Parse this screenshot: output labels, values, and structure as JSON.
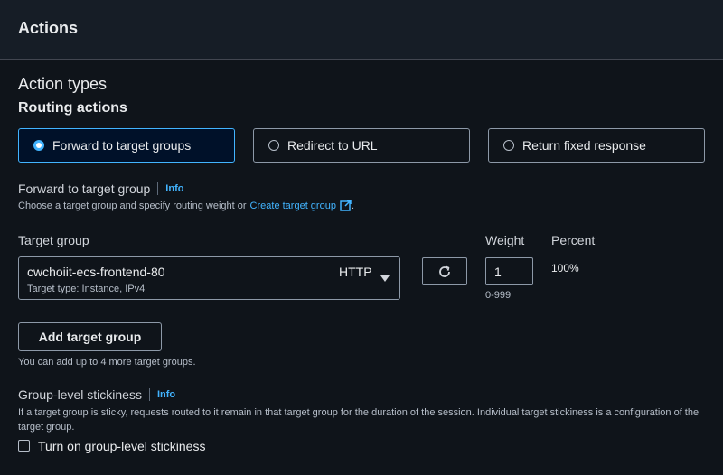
{
  "header": {
    "title": "Actions"
  },
  "action_types": {
    "heading": "Action types",
    "subheading": "Routing actions",
    "options": [
      {
        "label": "Forward to target groups",
        "selected": true
      },
      {
        "label": "Redirect to URL",
        "selected": false
      },
      {
        "label": "Return fixed response",
        "selected": false
      }
    ]
  },
  "forward": {
    "label": "Forward to target group",
    "info": "Info",
    "description_prefix": "Choose a target group and specify routing weight or",
    "link_text": "Create target group",
    "description_suffix": "."
  },
  "target_group": {
    "label": "Target group",
    "selected_value": "cwchoiit-ecs-frontend-80",
    "protocol": "HTTP",
    "subtext": "Target type: Instance, IPv4"
  },
  "weight": {
    "label": "Weight",
    "value": "1",
    "hint": "0-999"
  },
  "percent": {
    "label": "Percent",
    "value": "100%"
  },
  "add_target_group": {
    "button_label": "Add target group",
    "hint": "You can add up to 4 more target groups."
  },
  "stickiness": {
    "label": "Group-level stickiness",
    "info": "Info",
    "description": "If a target group is sticky, requests routed to it remain in that target group for the duration of the session. Individual target stickiness is a configuration of the target group.",
    "checkbox_label": "Turn on group-level stickiness",
    "checked": false
  },
  "colors": {
    "accent": "#42b4ff",
    "background": "#0f141a",
    "header_bg": "#161d26",
    "border": "#8d99a8"
  },
  "icons": [
    "external-link-icon",
    "refresh-icon",
    "caret-down-icon"
  ]
}
